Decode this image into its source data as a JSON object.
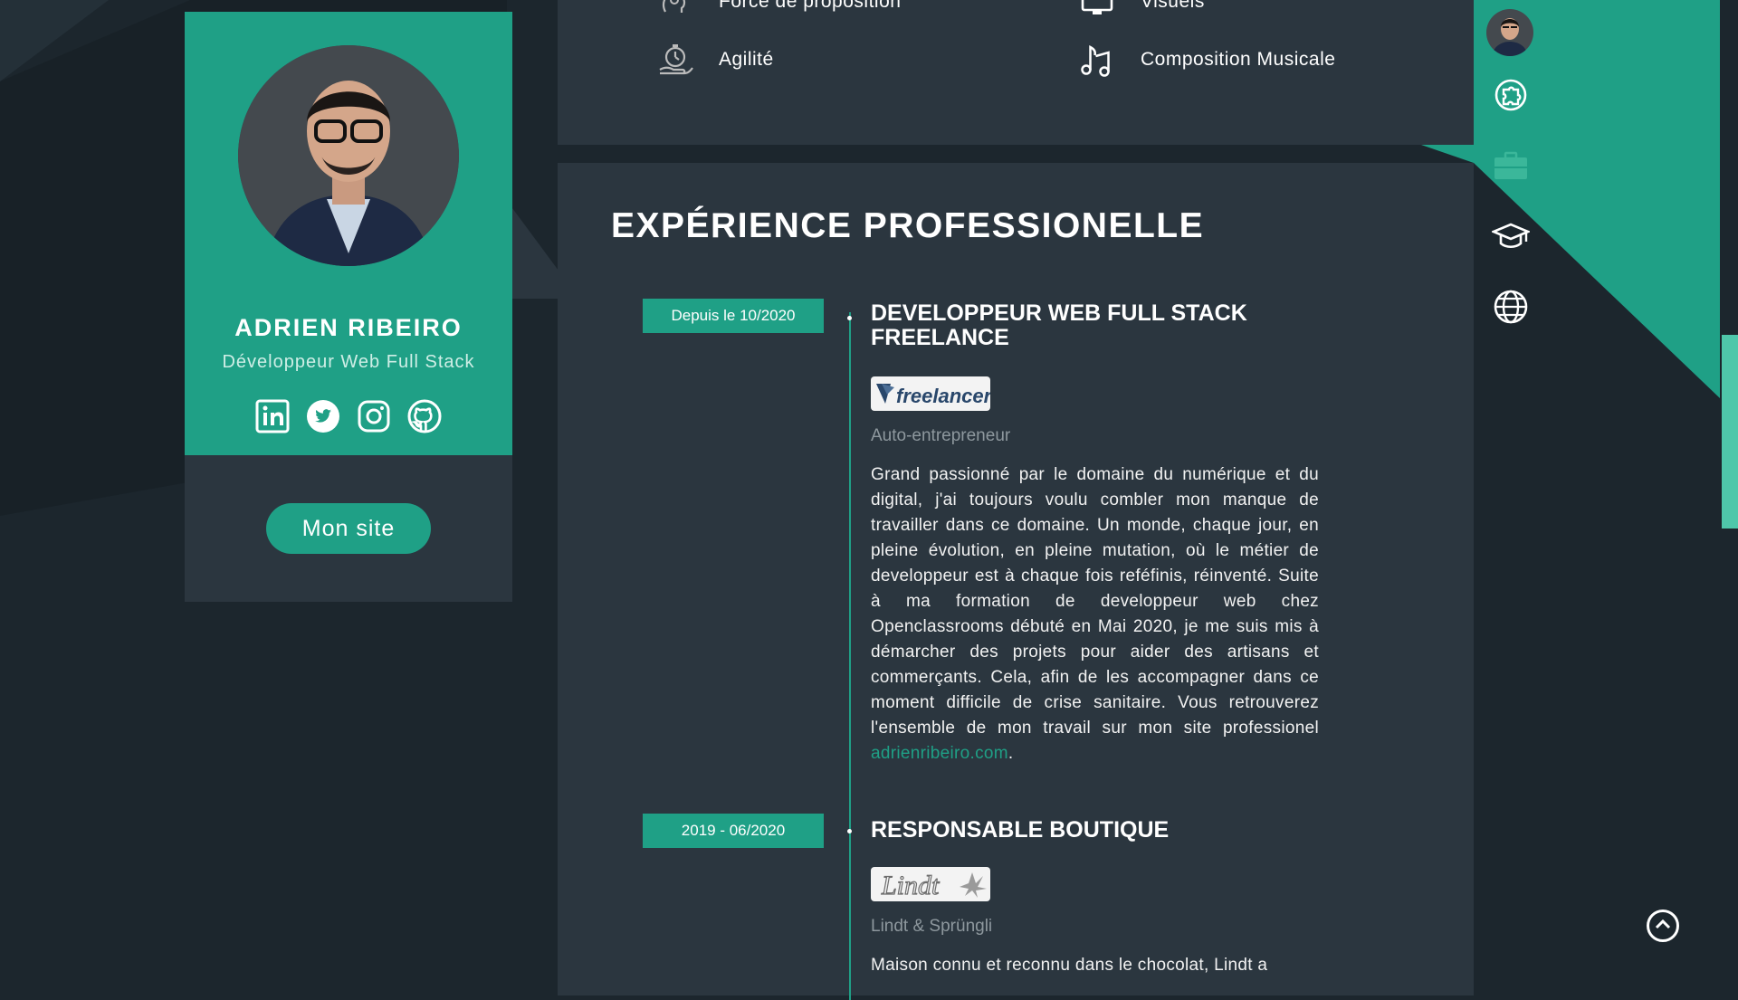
{
  "colors": {
    "accent": "#1fa086",
    "panel": "#2b363f",
    "background": "#1c262d"
  },
  "profile": {
    "name": "ADRIEN RIBEIRO",
    "role": "Développeur Web Full Stack",
    "socials": [
      "linkedin-icon",
      "twitter-icon",
      "instagram-icon",
      "github-icon"
    ],
    "site_button": "Mon site"
  },
  "skills": [
    {
      "label": "Force de proposition",
      "icon": "head-gears-icon"
    },
    {
      "label": "Visuels",
      "icon": "monitor-icon"
    },
    {
      "label": "Agilité",
      "icon": "stopwatch-hand-icon"
    },
    {
      "label": "Composition Musicale",
      "icon": "music-notes-icon"
    }
  ],
  "experience": {
    "title": "EXPÉRIENCE PROFESSIONELLE",
    "jobs": [
      {
        "date": "Depuis le 10/2020",
        "title": "DEVELOPPEUR WEB FULL STACK FREELANCE",
        "logo_text": "freelancer",
        "company": "Auto-entrepreneur",
        "description": "Grand passionné par le domaine du numérique et du digital, j'ai toujours voulu combler mon manque de travailler dans ce domaine. Un monde, chaque jour, en pleine évolution, en pleine mutation, où le métier de developpeur est à chaque fois reféfinis, réinventé. Suite à ma formation de developpeur web chez Openclassrooms débuté en Mai 2020, je me suis mis à démarcher des projets pour aider des artisans et commerçants. Cela, afin de les accompagner dans ce moment difficile de crise sanitaire. Vous retrouverez l'ensemble de mon travail sur mon site professionel ",
        "link_text": "adrienribeiro.com",
        "after_link": "."
      },
      {
        "date": "2019 - 06/2020",
        "title": "RESPONSABLE BOUTIQUE",
        "logo_text": "Lindt",
        "company": "Lindt & Sprüngli",
        "description": "Maison connu et reconnu dans le chocolat, Lindt a"
      }
    ]
  },
  "nav": [
    "profile-avatar",
    "puzzle-icon",
    "briefcase-icon",
    "graduation-cap-icon",
    "globe-icon"
  ]
}
